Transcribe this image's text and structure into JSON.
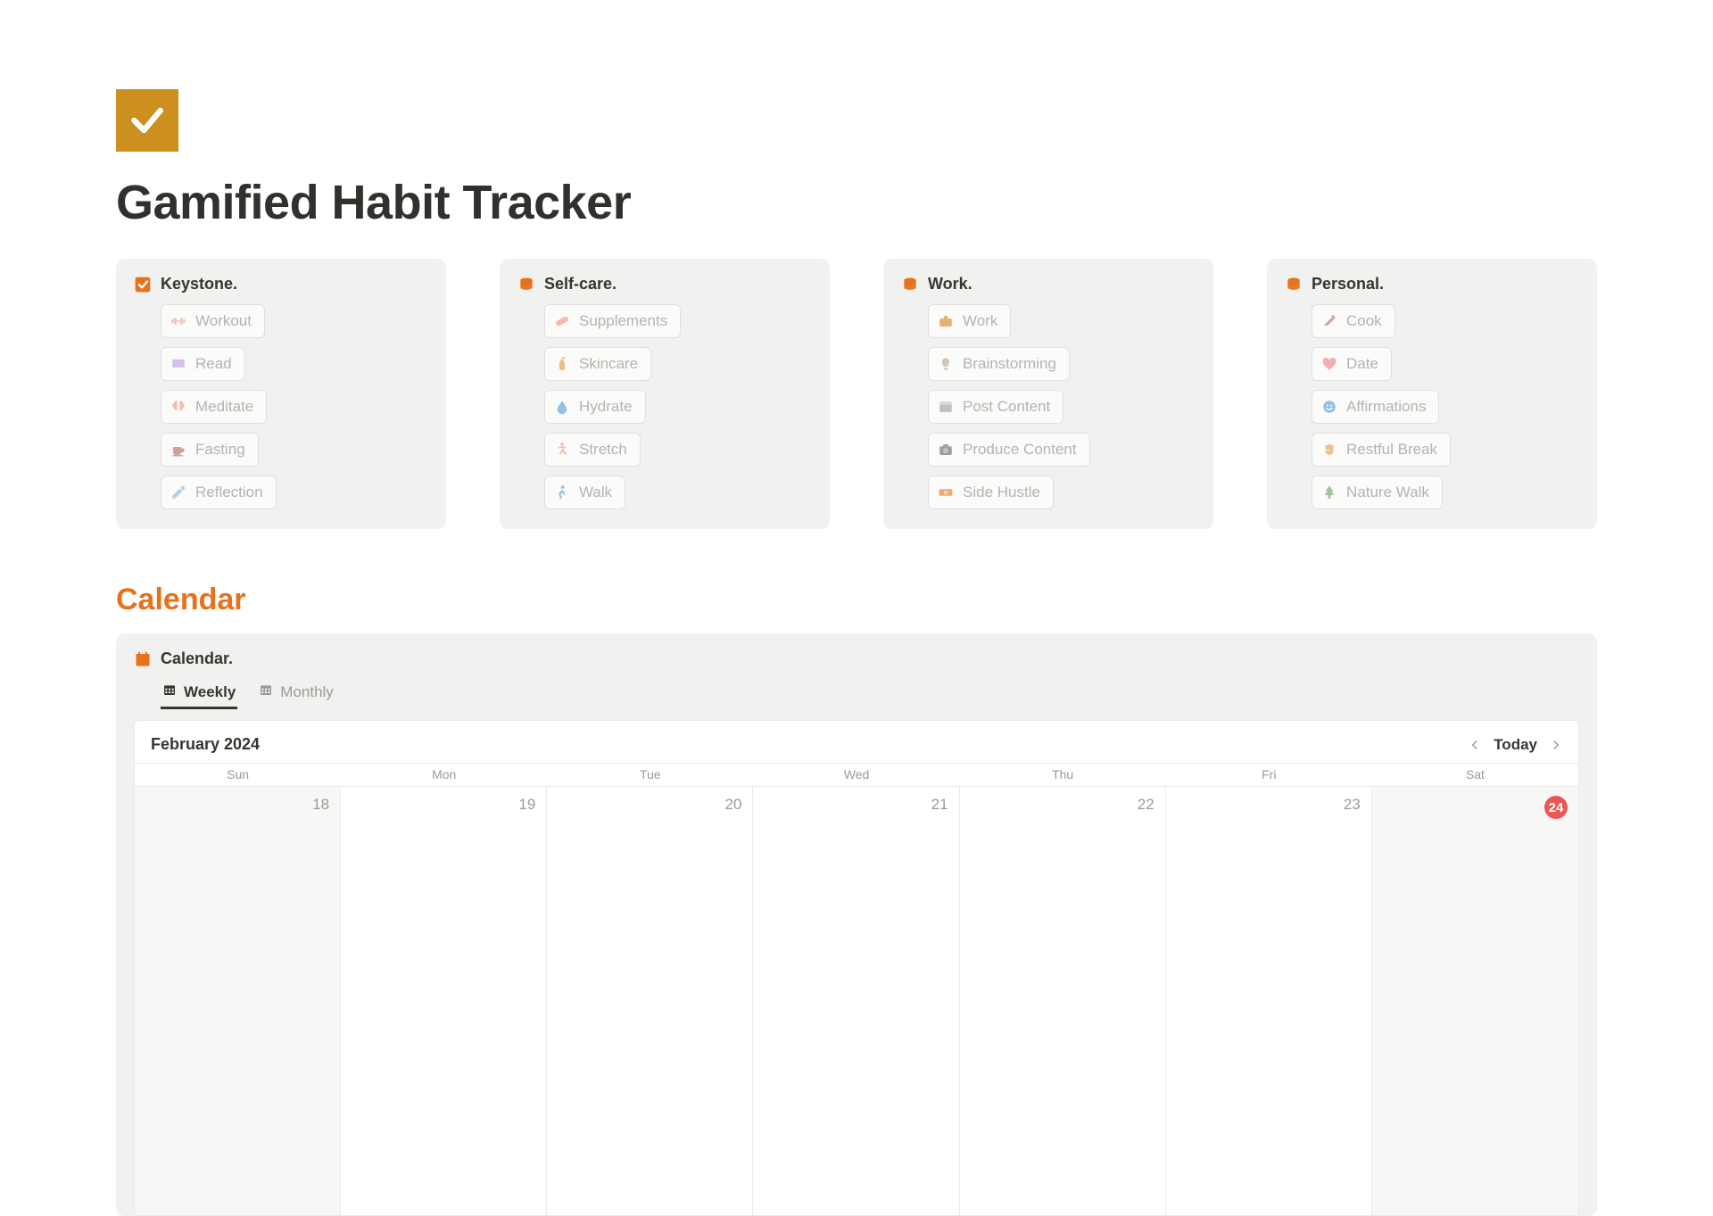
{
  "page": {
    "title": "Gamified Habit Tracker"
  },
  "cards": [
    {
      "id": "keystone",
      "title": "Keystone.",
      "icon": "check-square-orange",
      "items": [
        {
          "label": "Workout",
          "icon": "dumbbell",
          "color": "#f3b1a0"
        },
        {
          "label": "Read",
          "icon": "book-open",
          "color": "#cdb7e6"
        },
        {
          "label": "Meditate",
          "icon": "brain",
          "color": "#f3b1a0"
        },
        {
          "label": "Fasting",
          "icon": "mug",
          "color": "#c7928e"
        },
        {
          "label": "Reflection",
          "icon": "pencil",
          "color": "#a0c9e8"
        }
      ]
    },
    {
      "id": "selfcare",
      "title": "Self-care.",
      "icon": "stack-orange",
      "items": [
        {
          "label": "Supplements",
          "icon": "pill",
          "color": "#f3b1a0"
        },
        {
          "label": "Skincare",
          "icon": "lotion",
          "color": "#e5b567"
        },
        {
          "label": "Hydrate",
          "icon": "droplet",
          "color": "#7fb7e0"
        },
        {
          "label": "Stretch",
          "icon": "stretch",
          "color": "#f3b1a0"
        },
        {
          "label": "Walk",
          "icon": "walk",
          "color": "#7fb7e0"
        }
      ]
    },
    {
      "id": "work",
      "title": "Work.",
      "icon": "stack-orange",
      "items": [
        {
          "label": "Work",
          "icon": "briefcase",
          "color": "#e7a25b"
        },
        {
          "label": "Brainstorming",
          "icon": "bulb",
          "color": "#c9bfac"
        },
        {
          "label": "Post Content",
          "icon": "window",
          "color": "#b8b8b8"
        },
        {
          "label": "Produce Content",
          "icon": "camera",
          "color": "#8e8e8e"
        },
        {
          "label": "Side Hustle",
          "icon": "cash",
          "color": "#e7a25b"
        }
      ]
    },
    {
      "id": "personal",
      "title": "Personal.",
      "icon": "stack-orange",
      "items": [
        {
          "label": "Cook",
          "icon": "knife",
          "color": "#c7928e"
        },
        {
          "label": "Date",
          "icon": "heart",
          "color": "#f3a0a8"
        },
        {
          "label": "Affirmations",
          "icon": "smile",
          "color": "#7fb7e0"
        },
        {
          "label": "Restful Break",
          "icon": "hands",
          "color": "#e7b97a"
        },
        {
          "label": "Nature Walk",
          "icon": "tree",
          "color": "#8cbf8c"
        }
      ]
    }
  ],
  "section_calendar_heading": "Calendar",
  "calendar": {
    "title": "Calendar.",
    "tabs": [
      {
        "label": "Weekly",
        "active": true
      },
      {
        "label": "Monthly",
        "active": false
      }
    ],
    "month_label": "February 2024",
    "today_label": "Today",
    "weekdays": [
      "Sun",
      "Mon",
      "Tue",
      "Wed",
      "Thu",
      "Fri",
      "Sat"
    ],
    "dates": [
      {
        "num": "18",
        "is_today": false,
        "weekend": true
      },
      {
        "num": "19",
        "is_today": false,
        "weekend": false
      },
      {
        "num": "20",
        "is_today": false,
        "weekend": false
      },
      {
        "num": "21",
        "is_today": false,
        "weekend": false
      },
      {
        "num": "22",
        "is_today": false,
        "weekend": false
      },
      {
        "num": "23",
        "is_today": false,
        "weekend": false
      },
      {
        "num": "24",
        "is_today": true,
        "weekend": true
      }
    ]
  }
}
